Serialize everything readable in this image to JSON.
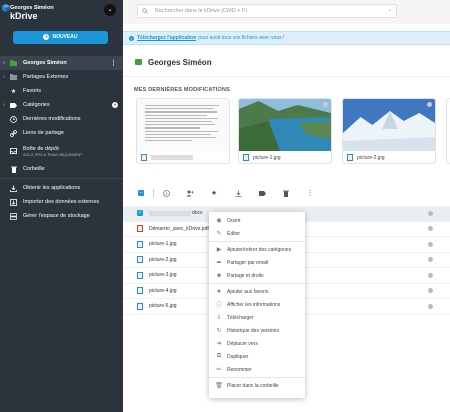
{
  "sidebar": {
    "user": "Georges Siméon",
    "app": "kDrive",
    "new_button": "NOUVEAU",
    "items": [
      {
        "label": "Georges Siméon",
        "icon": "folder-icon"
      },
      {
        "label": "Partages Externes",
        "icon": "share-icon"
      },
      {
        "label": "Favoris",
        "icon": "star-icon"
      },
      {
        "label": "Catégories",
        "icon": "tag-icon"
      },
      {
        "label": "Dernières modifications",
        "icon": "clock-icon"
      },
      {
        "label": "Liens de partage",
        "icon": "link-icon"
      },
      {
        "label": "Boîte de dépôt",
        "sub": "SOLO, PRO & TEAM UNIQUEMENT",
        "icon": "inbox-icon"
      },
      {
        "label": "Corbeille",
        "icon": "trash-icon"
      },
      {
        "label": "Obtenir les applications",
        "icon": "download-icon"
      },
      {
        "label": "Importer des données externes",
        "icon": "import-icon"
      },
      {
        "label": "Gérer l'espace de stockage",
        "icon": "storage-icon"
      }
    ]
  },
  "search": {
    "placeholder": "Rechercher dans le kDrive (CMD + F)"
  },
  "banner": {
    "link": "Téléchargez l'application",
    "text": "pour avoir tous vos fichiers avec vous !"
  },
  "header": {
    "title": "Georges Siméon"
  },
  "recent": {
    "label": "MES DERNIÈRES MODIFICATIONS",
    "cards": [
      {
        "name": ""
      },
      {
        "name": "picture-1.jpg"
      },
      {
        "name": "picture-2.jpg"
      }
    ]
  },
  "files": [
    {
      "name": "docx",
      "type": "doc"
    },
    {
      "name": "Démarrer_avec_kDrive.pdf",
      "type": "pdf"
    },
    {
      "name": "picture-1.jpg",
      "type": "img"
    },
    {
      "name": "picture-2.jpg",
      "type": "img"
    },
    {
      "name": "picture-3.jpg",
      "type": "img"
    },
    {
      "name": "picture-4.jpg",
      "type": "img"
    },
    {
      "name": "picture-5.jpg",
      "type": "img"
    }
  ],
  "context_menu": {
    "groups": [
      [
        "Ouvrir",
        "Éditer"
      ],
      [
        "Ajouter/retirer des catégories",
        "Partager par email",
        "Partage et droits"
      ],
      [
        "Ajouter aux favoris",
        "Afficher les informations",
        "Télécharger",
        "Historique des versions",
        "Déplacer vers",
        "Dupliquer",
        "Renommer"
      ],
      [
        "Placer dans la corbeille"
      ]
    ]
  },
  "colors": {
    "accent": "#1b96d8",
    "sidebar": "#2b333c",
    "folder": "#3ca63c",
    "pdf": "#d3423b"
  }
}
